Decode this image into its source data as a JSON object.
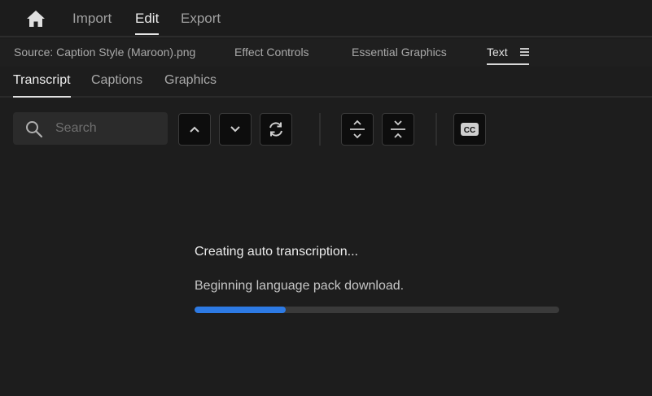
{
  "workspace": {
    "tabs": [
      {
        "label": "Import"
      },
      {
        "label": "Edit",
        "active": true
      },
      {
        "label": "Export"
      }
    ]
  },
  "panel_tabs": [
    {
      "label": "Source: Caption Style (Maroon).png"
    },
    {
      "label": "Effect Controls"
    },
    {
      "label": "Essential Graphics"
    },
    {
      "label": "Text",
      "active": true
    }
  ],
  "sub_tabs": [
    {
      "label": "Transcript",
      "active": true
    },
    {
      "label": "Captions"
    },
    {
      "label": "Graphics"
    }
  ],
  "search": {
    "placeholder": "Search",
    "value": ""
  },
  "toolbar": {
    "icons": [
      "chevron-up-icon",
      "chevron-down-icon",
      "sync-icon",
      "expand-vertical-icon",
      "collapse-vertical-icon",
      "closed-caption-icon"
    ],
    "cc_label": "CC"
  },
  "status": {
    "title": "Creating auto transcription...",
    "message": "Beginning language pack download.",
    "progress": 0.25
  },
  "colors": {
    "background": "#1d1d1d",
    "accent": "#2d7ae4",
    "button_bg": "#0d0d0d"
  }
}
